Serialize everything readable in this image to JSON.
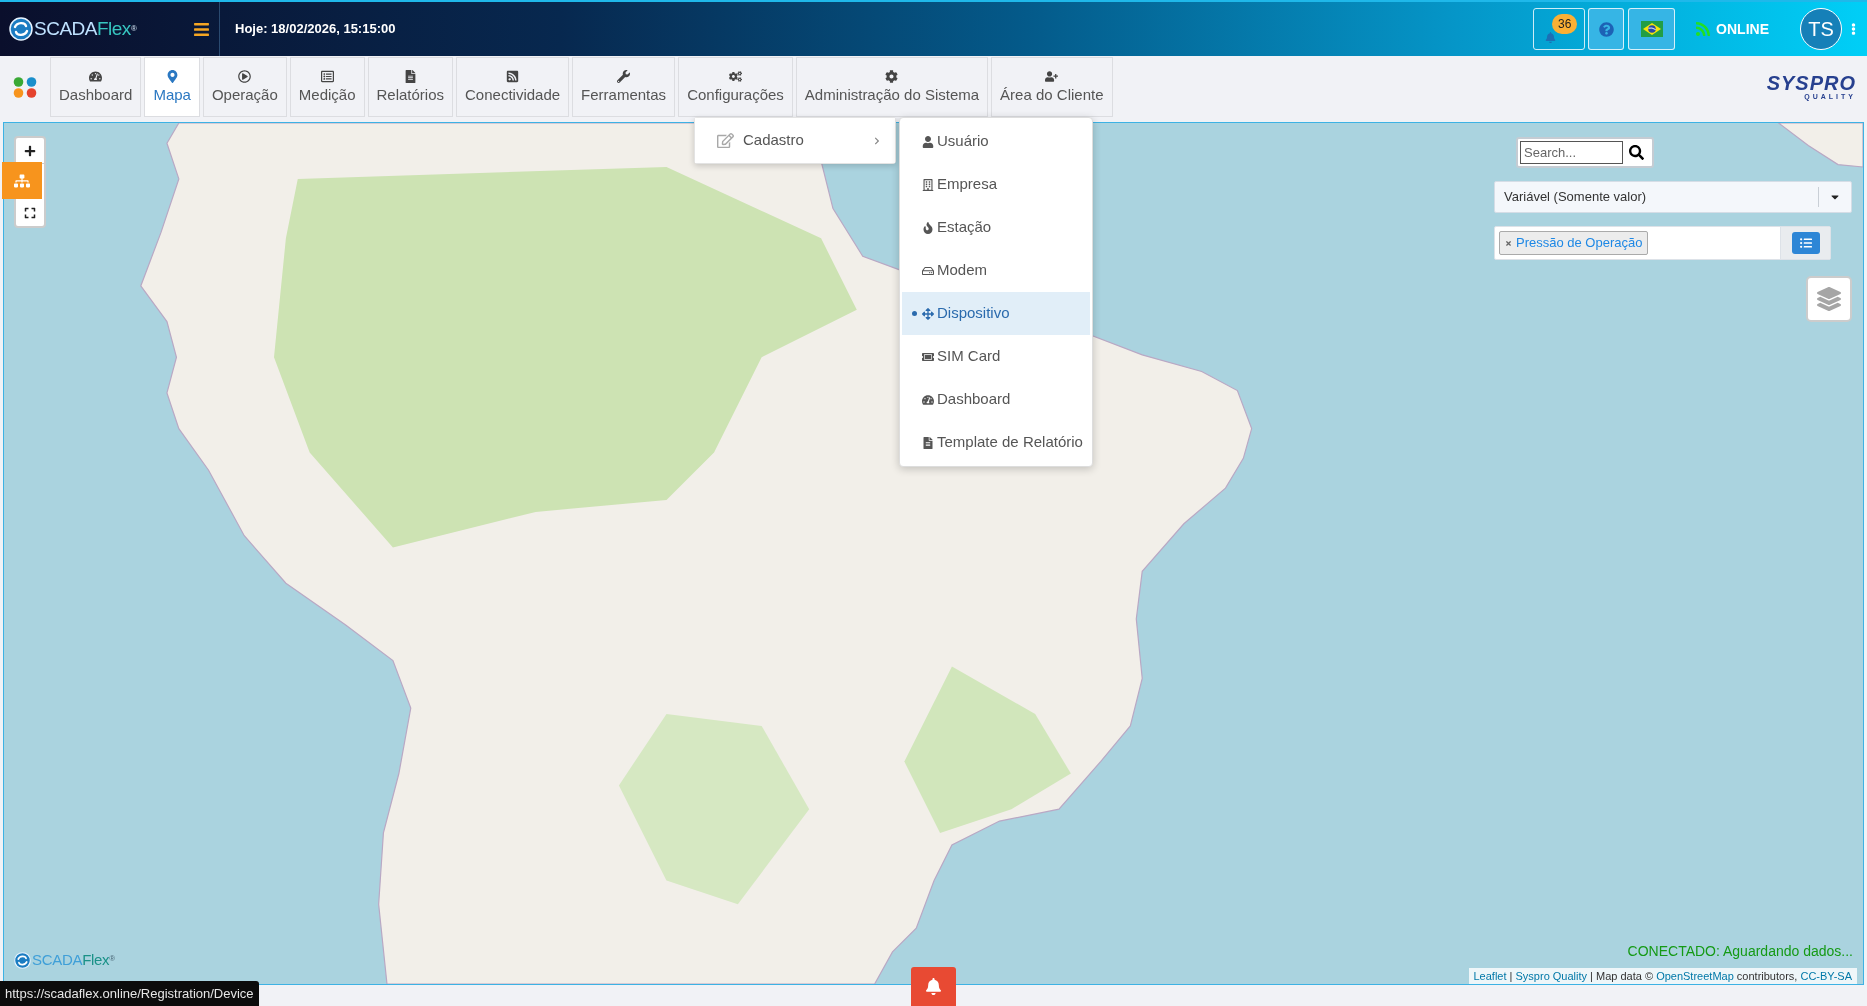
{
  "header": {
    "logo": {
      "prefix": "SCADA",
      "suffix": "Flex",
      "mark": "®"
    },
    "date": "Hoje: 18/02/2026, 15:15:00",
    "notification_count": "36",
    "connection": "ONLINE",
    "avatar_initials": "TS"
  },
  "nav_tabs": [
    {
      "label": "Dashboard",
      "selected": false
    },
    {
      "label": "Mapa",
      "selected": true
    },
    {
      "label": "Operação",
      "selected": false
    },
    {
      "label": "Medição",
      "selected": false
    },
    {
      "label": "Relatórios",
      "selected": false
    },
    {
      "label": "Conectividade",
      "selected": false
    },
    {
      "label": "Ferramentas",
      "selected": false
    },
    {
      "label": "Configurações",
      "selected": false
    },
    {
      "label": "Administração do Sistema",
      "selected": false
    },
    {
      "label": "Área do Cliente",
      "selected": false
    }
  ],
  "brand": {
    "name": "SYSPRO",
    "tagline": "QUALITY"
  },
  "config_menu": {
    "items": [
      {
        "label": "Cadastro",
        "expanded": true,
        "children": [
          {
            "label": "Usuário",
            "selected": false
          },
          {
            "label": "Empresa",
            "selected": false
          },
          {
            "label": "Estação",
            "selected": false
          },
          {
            "label": "Modem",
            "selected": false
          },
          {
            "label": "Dispositivo",
            "selected": true
          },
          {
            "label": "SIM Card",
            "selected": false
          },
          {
            "label": "Dashboard",
            "selected": false
          },
          {
            "label": "Template de Relatório",
            "selected": false
          }
        ]
      }
    ]
  },
  "map": {
    "search": {
      "placeholder": "Search..."
    },
    "variable_select": {
      "value": "Variável (Somente valor)"
    },
    "selected_variables": [
      {
        "label": "Pressão de Operação"
      }
    ],
    "logo": {
      "prefix": "SCADA",
      "suffix": "Flex",
      "mark": "®"
    },
    "connection_status": "CONECTADO: Aguardando dados...",
    "attribution": [
      {
        "kind": "link",
        "text": "Leaflet"
      },
      {
        "kind": "text",
        "text": "|"
      },
      {
        "kind": "link",
        "text": "Syspro Quality"
      },
      {
        "kind": "text",
        "text": "| Map data ©"
      },
      {
        "kind": "link",
        "text": "OpenStreetMap"
      },
      {
        "kind": "text",
        "text": "contributors,"
      },
      {
        "kind": "link",
        "text": "CC-BY-SA"
      }
    ]
  },
  "link_preview": "https://scadaflex.online/Registration/Device"
}
